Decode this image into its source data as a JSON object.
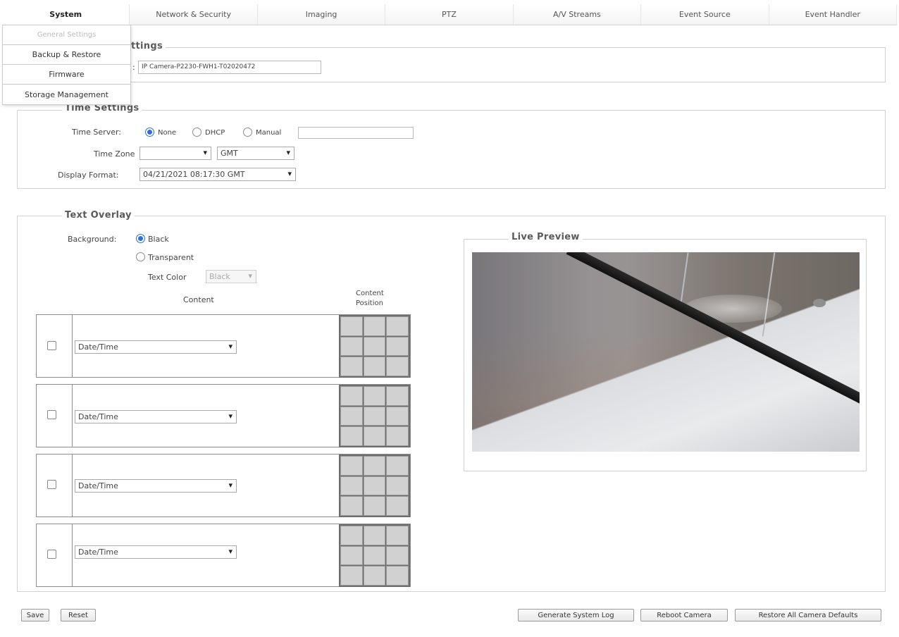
{
  "nav": {
    "tabs": [
      {
        "label": "System"
      },
      {
        "label": "Network & Security"
      },
      {
        "label": "Imaging"
      },
      {
        "label": "PTZ"
      },
      {
        "label": "A/V Streams"
      },
      {
        "label": "Event Source"
      },
      {
        "label": "Event Handler"
      }
    ],
    "active": "System"
  },
  "submenu": {
    "items": [
      {
        "label": "General Settings"
      },
      {
        "label": "Backup & Restore"
      },
      {
        "label": "Firmware"
      },
      {
        "label": "Storage Management"
      }
    ]
  },
  "device_settings": {
    "legend_fragment": "ttings",
    "name_label_fragment": ":",
    "camera_name": "IP Camera-P2230-FWH1-T02020472"
  },
  "time_settings": {
    "legend": "Time Settings",
    "time_server_label": "Time Server:",
    "options": [
      "None",
      "DHCP",
      "Manual"
    ],
    "selected": "None",
    "manual_value": "",
    "time_zone_label": "Time Zone",
    "time_zone_value": "",
    "gmt_value": "GMT",
    "display_format_label": "Display Format:",
    "display_format_value": "04/21/2021 08:17:30 GMT"
  },
  "text_overlay": {
    "legend": "Text Overlay",
    "background_label": "Background:",
    "background_options": [
      "Black",
      "Transparent"
    ],
    "background_selected": "Black",
    "text_color_label": "Text Color",
    "text_color_value": "Black",
    "content_header": "Content",
    "position_header_line1": "Content",
    "position_header_line2": "Position",
    "rows": [
      {
        "checked": false,
        "content": "Date/Time"
      },
      {
        "checked": false,
        "content": "Date/Time"
      },
      {
        "checked": false,
        "content": "Date/Time"
      },
      {
        "checked": false,
        "content": "Date/Time"
      }
    ]
  },
  "live_preview": {
    "legend": "Live Preview"
  },
  "buttons": {
    "save": "Save",
    "reset": "Reset",
    "generate_log": "Generate System Log",
    "reboot": "Reboot Camera",
    "restore": "Restore All Camera Defaults"
  },
  "colors": {
    "radio_accent": "#2d6fd6",
    "legend_text": "#5a5a5a"
  }
}
